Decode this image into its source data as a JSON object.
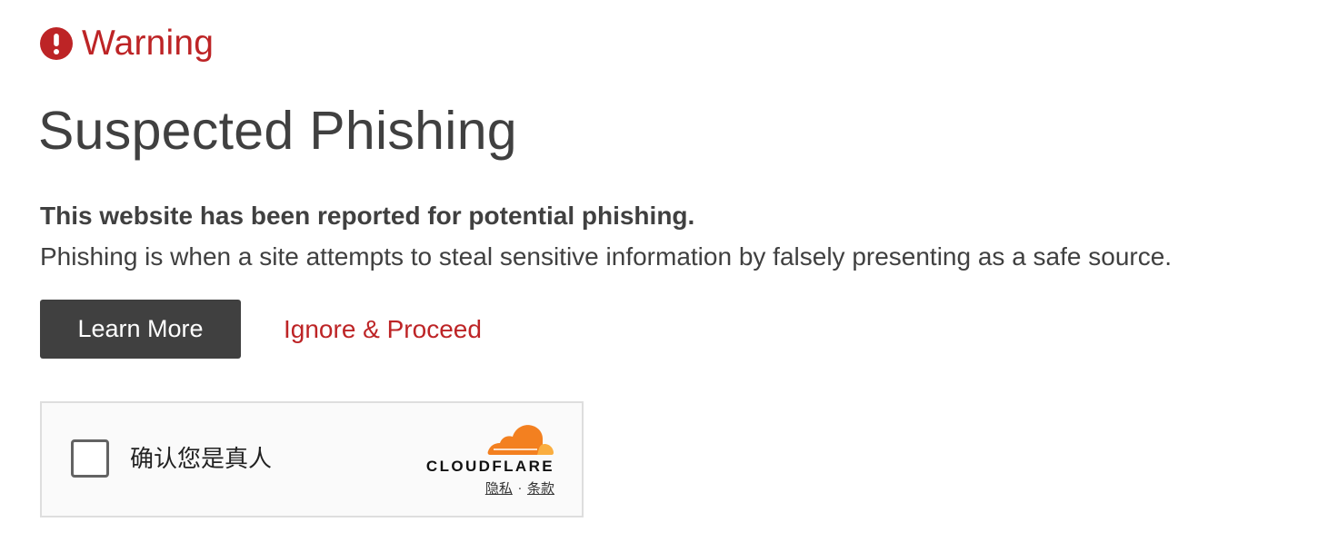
{
  "warning": {
    "label": "Warning",
    "icon": "exclamation-circle-icon",
    "color": "#bd2426"
  },
  "title": "Suspected Phishing",
  "headline": "This website has been reported for potential phishing.",
  "description": "Phishing is when a site attempts to steal sensitive information by falsely presenting as a safe source.",
  "actions": {
    "learn_more_label": "Learn More",
    "ignore_label": "Ignore & Proceed"
  },
  "turnstile": {
    "checkbox_label": "确认您是真人",
    "brand": "CLOUDFLARE",
    "brand_icon": "cloudflare-cloud-icon",
    "privacy_label": "隐私",
    "separator": "·",
    "terms_label": "条款",
    "brand_colors": [
      "#f38020",
      "#faae40"
    ]
  },
  "colors": {
    "text": "#404040",
    "button_bg": "#404040",
    "accent": "#bd2426"
  }
}
